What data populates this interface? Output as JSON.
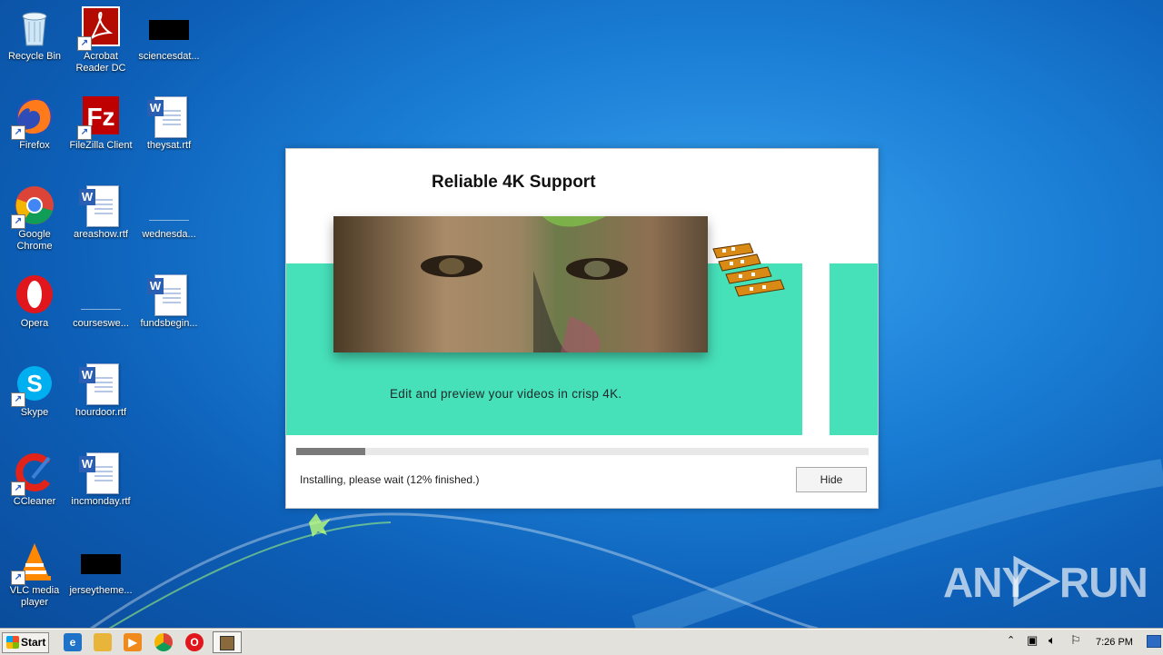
{
  "desktop": {
    "icons": [
      {
        "label": "Recycle Bin"
      },
      {
        "label": "Acrobat\nReader DC"
      },
      {
        "label": "sciencesdat..."
      },
      {
        "label": "Firefox"
      },
      {
        "label": "FileZilla Client"
      },
      {
        "label": "theysat.rtf"
      },
      {
        "label": "Google\nChrome"
      },
      {
        "label": "areashow.rtf"
      },
      {
        "label": "wednesda..."
      },
      {
        "label": "Opera"
      },
      {
        "label": "courseswe..."
      },
      {
        "label": "fundsbegin..."
      },
      {
        "label": "Skype"
      },
      {
        "label": "hourdoor.rtf"
      },
      {
        "label": "CCleaner"
      },
      {
        "label": "incmonday.rtf"
      },
      {
        "label": "VLC media\nplayer"
      },
      {
        "label": "jerseytheme..."
      }
    ]
  },
  "installer": {
    "slide_title": "Reliable 4K Support",
    "caption": "Edit and preview your videos in crisp 4K.",
    "progress_fraction": 0.12,
    "status": "Installing, please wait (12% finished.)",
    "hide_label": "Hide"
  },
  "watermark": {
    "text_left": "ANY",
    "text_right": "RUN"
  },
  "taskbar": {
    "start_label": "Start",
    "pinned": [
      "internet-explorer-icon",
      "explorer-icon",
      "media-player-icon",
      "chrome-icon",
      "opera-icon"
    ],
    "active_app": "installer-icon",
    "clock": "7:26 PM"
  },
  "colors": {
    "teal": "#46e0b9",
    "progress_fill": "#7a7a7a",
    "taskbar": "#e3e1dc"
  }
}
